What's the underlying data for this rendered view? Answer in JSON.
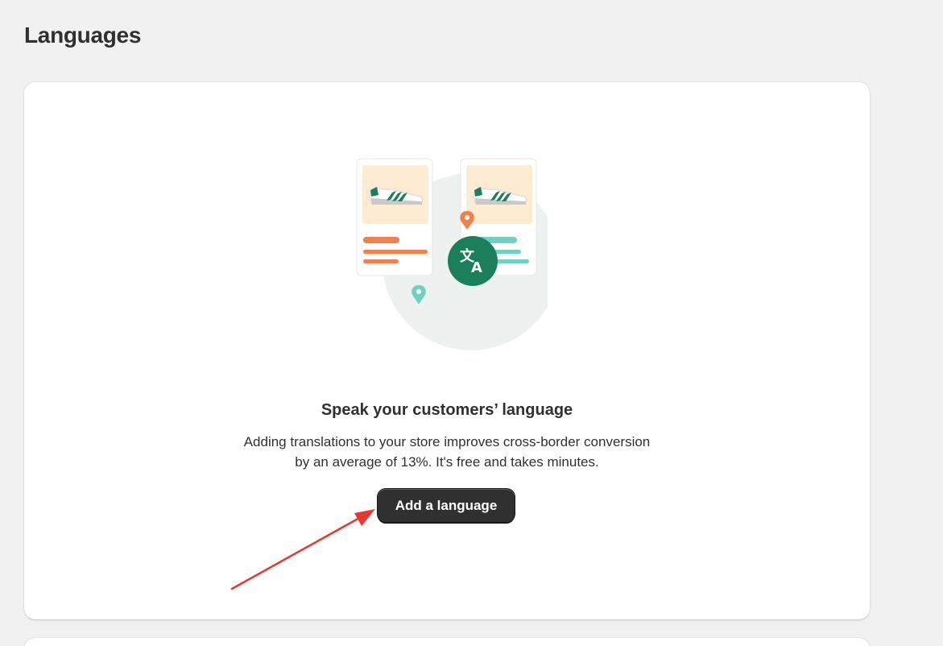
{
  "page": {
    "title": "Languages"
  },
  "empty_state": {
    "heading": "Speak your customers’ language",
    "body_line1": "Adding translations to your store improves cross-border conversion",
    "body_line2": "by an average of 13%. It's free and takes minutes.",
    "action_label": "Add a language"
  },
  "illustration": {
    "icon": "translate-icon",
    "pins": [
      "location-pin-icon",
      "location-pin-icon"
    ],
    "product_cards": [
      "sneaker-icon",
      "sneaker-icon"
    ]
  },
  "annotation": {
    "type": "red-arrow",
    "target": "add-language-button",
    "color": "#e8372f"
  },
  "colors": {
    "background": "#f1f1f1",
    "card": "#ffffff",
    "primary_button": "#303030",
    "accent_green": "#1a7f5a",
    "accent_orange": "#f2804a",
    "accent_teal": "#6fd0c3"
  }
}
